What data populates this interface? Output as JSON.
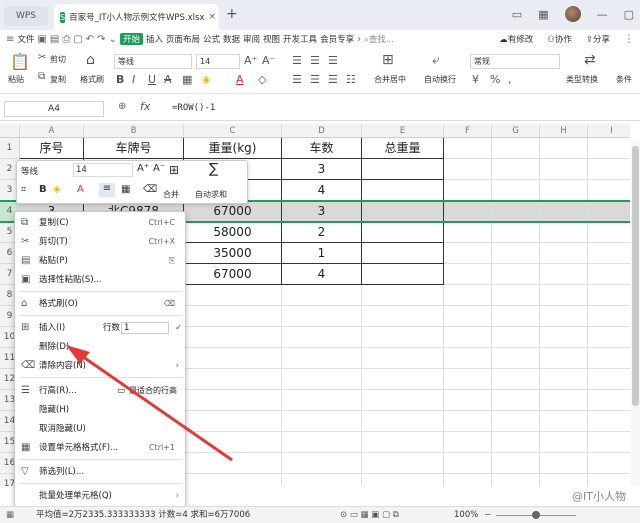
{
  "titlebar": {
    "wps_label": "WPS",
    "file_name": "百家号_IT小人物示例文件WPS.xlsx",
    "close_glyph": "×",
    "new_tab_glyph": "+"
  },
  "menubar": {
    "items": [
      "文件",
      "开始",
      "插入",
      "页面布局",
      "公式",
      "数据",
      "审阅",
      "视图",
      "开发工具",
      "会员专享"
    ],
    "search": "查找...",
    "right": [
      "有修改",
      "协作",
      "分享"
    ]
  },
  "ribbon": {
    "paste": "粘贴",
    "cut": "剪切",
    "copy": "复制",
    "format_painter": "格式刷",
    "font_name": "等线",
    "font_size": "14",
    "merge": "合并居中",
    "wrap": "自动换行",
    "number_format": "常规",
    "type_convert": "类型转换",
    "cond_format": "条件"
  },
  "formula_bar": {
    "cell_ref": "A4",
    "fx": "fx",
    "formula": "=ROW()-1"
  },
  "columns": [
    "A",
    "B",
    "C",
    "D",
    "E",
    "F",
    "G",
    "H",
    "I"
  ],
  "rows": [
    "1",
    "2",
    "3",
    "4",
    "5",
    "6",
    "7",
    "8",
    "9",
    "10",
    "11",
    "12",
    "13",
    "14",
    "15",
    "16",
    "17",
    "18",
    "19"
  ],
  "table": {
    "headers": [
      "序号",
      "车牌号",
      "重量(kg)",
      "车数",
      "总重量"
    ],
    "row2": [
      "",
      "",
      "000",
      "3",
      ""
    ],
    "row3": [
      "",
      "",
      "000",
      "4",
      ""
    ],
    "row4": [
      "3",
      "北C9878",
      "67000",
      "3",
      ""
    ],
    "row5": [
      "",
      "",
      "58000",
      "2",
      ""
    ],
    "row6": [
      "",
      "",
      "35000",
      "1",
      ""
    ],
    "row7": [
      "",
      "",
      "67000",
      "4",
      ""
    ]
  },
  "mini_toolbar": {
    "font": "等线",
    "size": "14",
    "merge": "合并",
    "autosum": "自动求和"
  },
  "context_menu": {
    "copy": "复制(C)",
    "copy_sc": "Ctrl+C",
    "cut": "剪切(T)",
    "cut_sc": "Ctrl+X",
    "paste": "粘贴(P)",
    "paste_special": "选择性粘贴(S)...",
    "format_painter": "格式刷(O)",
    "insert": "插入(I)",
    "rows_label": "行数:",
    "rows_value": "1",
    "delete": "删除(D)",
    "clear": "清除内容(N)",
    "row_height": "行高(R)...",
    "best_fit": "最适合的行高",
    "hide": "隐藏(H)",
    "unhide": "取消隐藏(U)",
    "format_cells": "设置单元格格式(F)...",
    "format_cells_sc": "Ctrl+1",
    "filter_col": "筛选列(L)...",
    "batch": "批量处理单元格(Q)"
  },
  "statusbar": {
    "stats": "平均值=2万2335.333333333  计数=4  求和=6万7006",
    "zoom": "100%"
  },
  "watermark": "@IT小人物",
  "colors": {
    "accent": "#1e9c5a",
    "selected_row": "#d9d9d9",
    "arrow": "#e53935"
  }
}
